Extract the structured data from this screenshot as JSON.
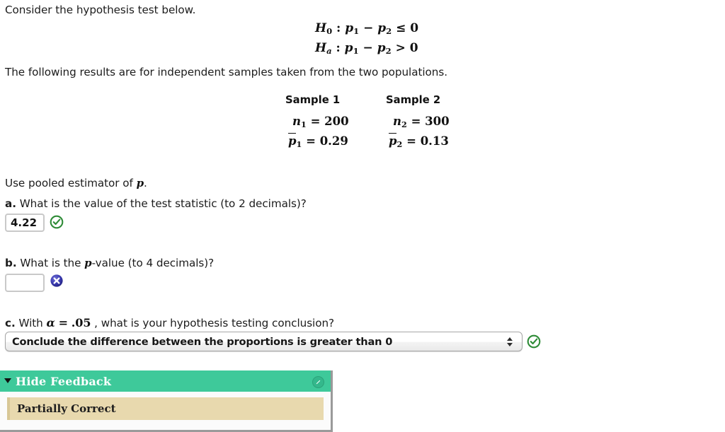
{
  "intro": {
    "prompt": "Consider the hypothesis test below.",
    "results_note": "The following results are for independent samples taken from the two populations.",
    "pooled_note_prefix": "Use pooled estimator of ",
    "pooled_note_symbol": "p",
    "pooled_note_suffix": "."
  },
  "hypotheses": {
    "null": {
      "label": "H",
      "label_sub": "0",
      "colon": ":",
      "term1": "p",
      "term1_sub": "1",
      "minus": "−",
      "term2": "p",
      "term2_sub": "2",
      "relation": "≤",
      "value": "0"
    },
    "alt": {
      "label": "H",
      "label_sub": "a",
      "colon": ":",
      "term1": "p",
      "term1_sub": "1",
      "minus": "−",
      "term2": "p",
      "term2_sub": "2",
      "relation": ">",
      "value": "0"
    }
  },
  "samples": {
    "headers": [
      "Sample 1",
      "Sample 2"
    ],
    "rows": [
      {
        "symbol": "n",
        "sub_1": "1",
        "sub_2": "2",
        "eq": "=",
        "value_1": "200",
        "value_2": "300"
      },
      {
        "symbol": "p",
        "sub_1": "1",
        "sub_2": "2",
        "eq": "=",
        "value_1": "0.29",
        "value_2": "0.13"
      }
    ]
  },
  "questions": {
    "a": {
      "letter": "a.",
      "text": " What is the value of the test statistic (to 2 decimals)?",
      "answer_value": "4.22",
      "status": "correct",
      "status_icon": "check-circle-icon"
    },
    "b": {
      "letter": "b.",
      "text_before": " What is the ",
      "symbol": "p",
      "text_after": "-value (to 4 decimals)?",
      "answer_value": "",
      "placeholder": "",
      "status": "incorrect",
      "status_icon": "x-circle-icon"
    },
    "c": {
      "letter": "c.",
      "text_before": " With ",
      "alpha": "α",
      "eq": "=",
      "alpha_value": ".05",
      "text_after": " , what is your hypothesis testing conclusion?",
      "selected_option": "Conclude the difference between the proportions is greater than 0",
      "status": "correct",
      "status_icon": "check-circle-icon"
    }
  },
  "feedback": {
    "toggle_label": "Hide Feedback",
    "disclosure_icon": "triangle-down-icon",
    "edit_icon": "edit-circle-icon",
    "result_label": "Partially Correct"
  },
  "colors": {
    "feedback_header": "#3ec99a",
    "partial_banner": "#e8d9ae",
    "correct_green": "#2e8b37",
    "incorrect_blue": "#2a2a9c",
    "text": "#1a1a1a"
  }
}
